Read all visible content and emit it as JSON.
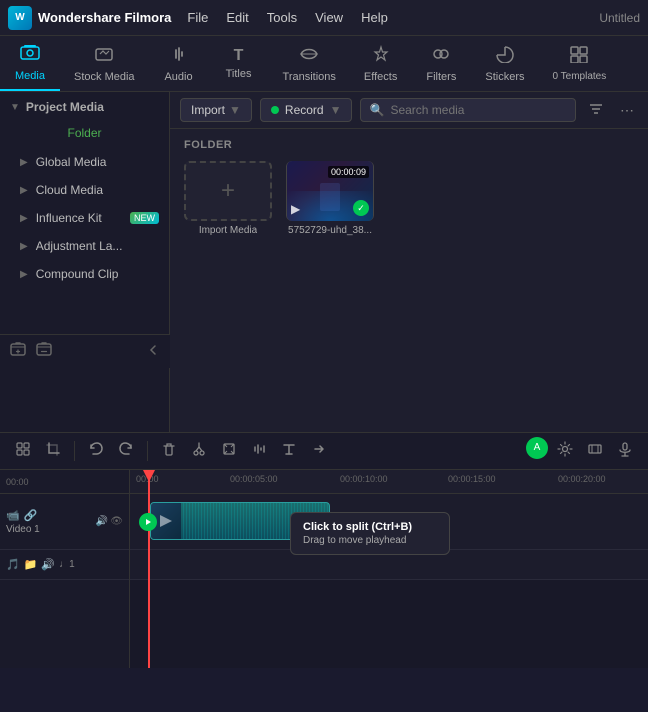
{
  "app": {
    "logo_text": "Wondershare Filmora",
    "title": "Untitled"
  },
  "menu": {
    "items": [
      "File",
      "Edit",
      "Tools",
      "View",
      "Help"
    ]
  },
  "toolbar_tabs": [
    {
      "id": "media",
      "label": "Media",
      "icon": "🎬",
      "active": true
    },
    {
      "id": "stock-media",
      "label": "Stock Media",
      "icon": "🏪"
    },
    {
      "id": "audio",
      "label": "Audio",
      "icon": "🎵"
    },
    {
      "id": "titles",
      "label": "Titles",
      "icon": "T"
    },
    {
      "id": "transitions",
      "label": "Transitions",
      "icon": "⬡"
    },
    {
      "id": "effects",
      "label": "Effects",
      "icon": "✨"
    },
    {
      "id": "filters",
      "label": "Filters",
      "icon": "🎨"
    },
    {
      "id": "stickers",
      "label": "Stickers",
      "icon": "⭐"
    },
    {
      "id": "templates",
      "label": "Templates",
      "icon": "⊞",
      "badge": "0"
    }
  ],
  "sidebar": {
    "header": "Project Media",
    "folder_label": "Folder",
    "items": [
      {
        "label": "Global Media",
        "has_badge": false
      },
      {
        "label": "Cloud Media",
        "has_badge": false
      },
      {
        "label": "Influence Kit",
        "has_badge": true,
        "badge_text": "NEW"
      },
      {
        "label": "Adjustment La...",
        "has_badge": false
      },
      {
        "label": "Compound Clip",
        "has_badge": false
      }
    ],
    "add_folder_label": "+",
    "remove_folder_label": "−"
  },
  "content": {
    "import_label": "Import",
    "record_label": "Record",
    "search_placeholder": "Search media",
    "folder_section_label": "FOLDER",
    "import_media_label": "Import Media",
    "media_item": {
      "name": "5752729-uhd_38...",
      "duration": "00:00:09"
    }
  },
  "timeline": {
    "toolbar_icons": [
      "select",
      "crop",
      "undo",
      "redo",
      "delete",
      "cut",
      "transform",
      "audio",
      "text",
      "more"
    ],
    "right_icons": [
      "auto_sync",
      "settings",
      "clip",
      "mic"
    ],
    "tracks": [
      {
        "id": "video1",
        "label": "Video 1",
        "icons": [
          "📹",
          "🔗",
          "🔊",
          "👁"
        ]
      }
    ],
    "audio_tracks": [
      {
        "id": "audio1",
        "icons": [
          "🎵",
          "📁",
          "🔊"
        ]
      }
    ],
    "timescale": [
      {
        "label": "00:00",
        "offset": 0
      },
      {
        "label": "00:00:05:00",
        "offset": 100
      },
      {
        "label": "00:00:10:00",
        "offset": 215
      },
      {
        "label": "00:00:15:00",
        "offset": 325
      },
      {
        "label": "00:00:20:00",
        "offset": 435
      }
    ],
    "tooltip": {
      "title": "Click to split (Ctrl+B)",
      "subtitle": "Drag to move playhead"
    }
  }
}
